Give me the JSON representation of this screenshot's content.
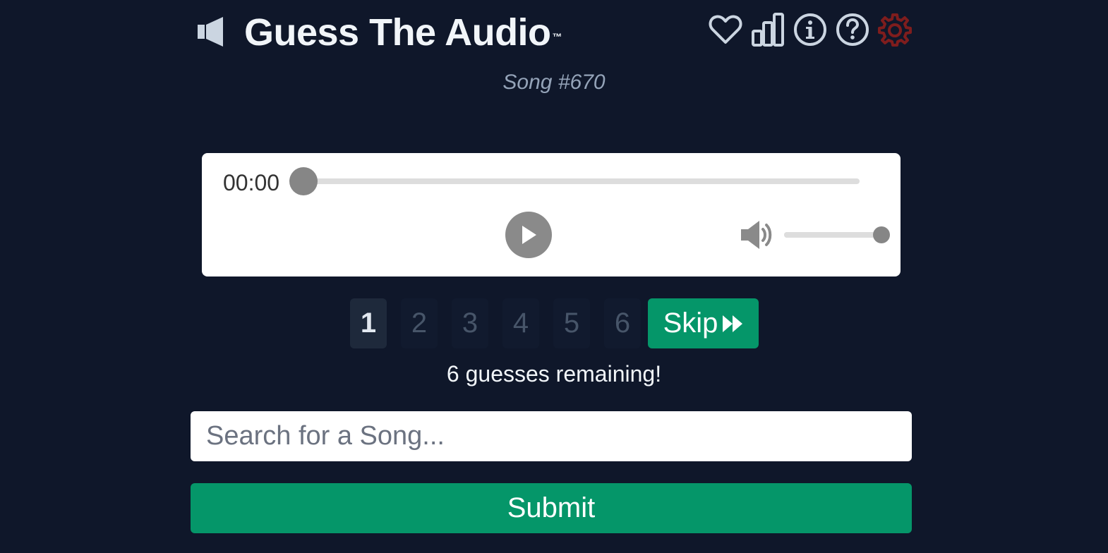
{
  "header": {
    "title": "Guess The Audio",
    "trademark": "™",
    "icons": [
      "heart-icon",
      "stats-icon",
      "info-icon",
      "help-icon",
      "settings-icon"
    ]
  },
  "subtitle": "Song #670",
  "player": {
    "time": "00:00",
    "progress": 0,
    "volume": 1.0
  },
  "steps": {
    "items": [
      "1",
      "2",
      "3",
      "4",
      "5",
      "6"
    ],
    "active": "1",
    "skip_label": "Skip"
  },
  "status": {
    "remaining": "6 guesses remaining!"
  },
  "search": {
    "placeholder": "Search for a Song...",
    "value": ""
  },
  "submit_label": "Submit",
  "colors": {
    "background": "#0f172a",
    "accent_green": "#059669",
    "settings_red": "#7f1d1d",
    "icon_gray": "#cbd5e1"
  }
}
